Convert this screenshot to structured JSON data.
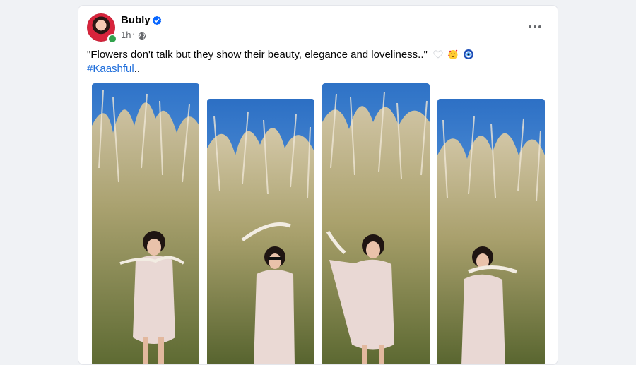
{
  "post": {
    "author": "Bubly",
    "time": "1h",
    "privacy_icon": "globe-icon",
    "verified_icon": "verified-badge-icon",
    "more_icon": "more-options-icon",
    "caption_text": "\"Flowers don't talk but they show their beauty, elegance and loveliness..\"",
    "caption_emojis": [
      "white-heart-emoji",
      "smiling-face-with-hearts-emoji",
      "nazar-amulet-emoji"
    ],
    "hashtag": "#Kaashful",
    "hashtag_suffix": ".."
  },
  "photos": [
    {
      "name": "photo-1",
      "subject": "woman in floral dress among kaash flowers"
    },
    {
      "name": "photo-2",
      "subject": "woman with sunglasses holding kaash flower"
    },
    {
      "name": "photo-3",
      "subject": "woman raising kaash flower"
    },
    {
      "name": "photo-4",
      "subject": "woman holding kaash flower near face"
    }
  ],
  "colors": {
    "sky_top": "#2f73c8",
    "sky_bottom": "#7eb2e6",
    "grass": "#6f7a3e",
    "link": "#216fdb",
    "online": "#31a24c"
  }
}
